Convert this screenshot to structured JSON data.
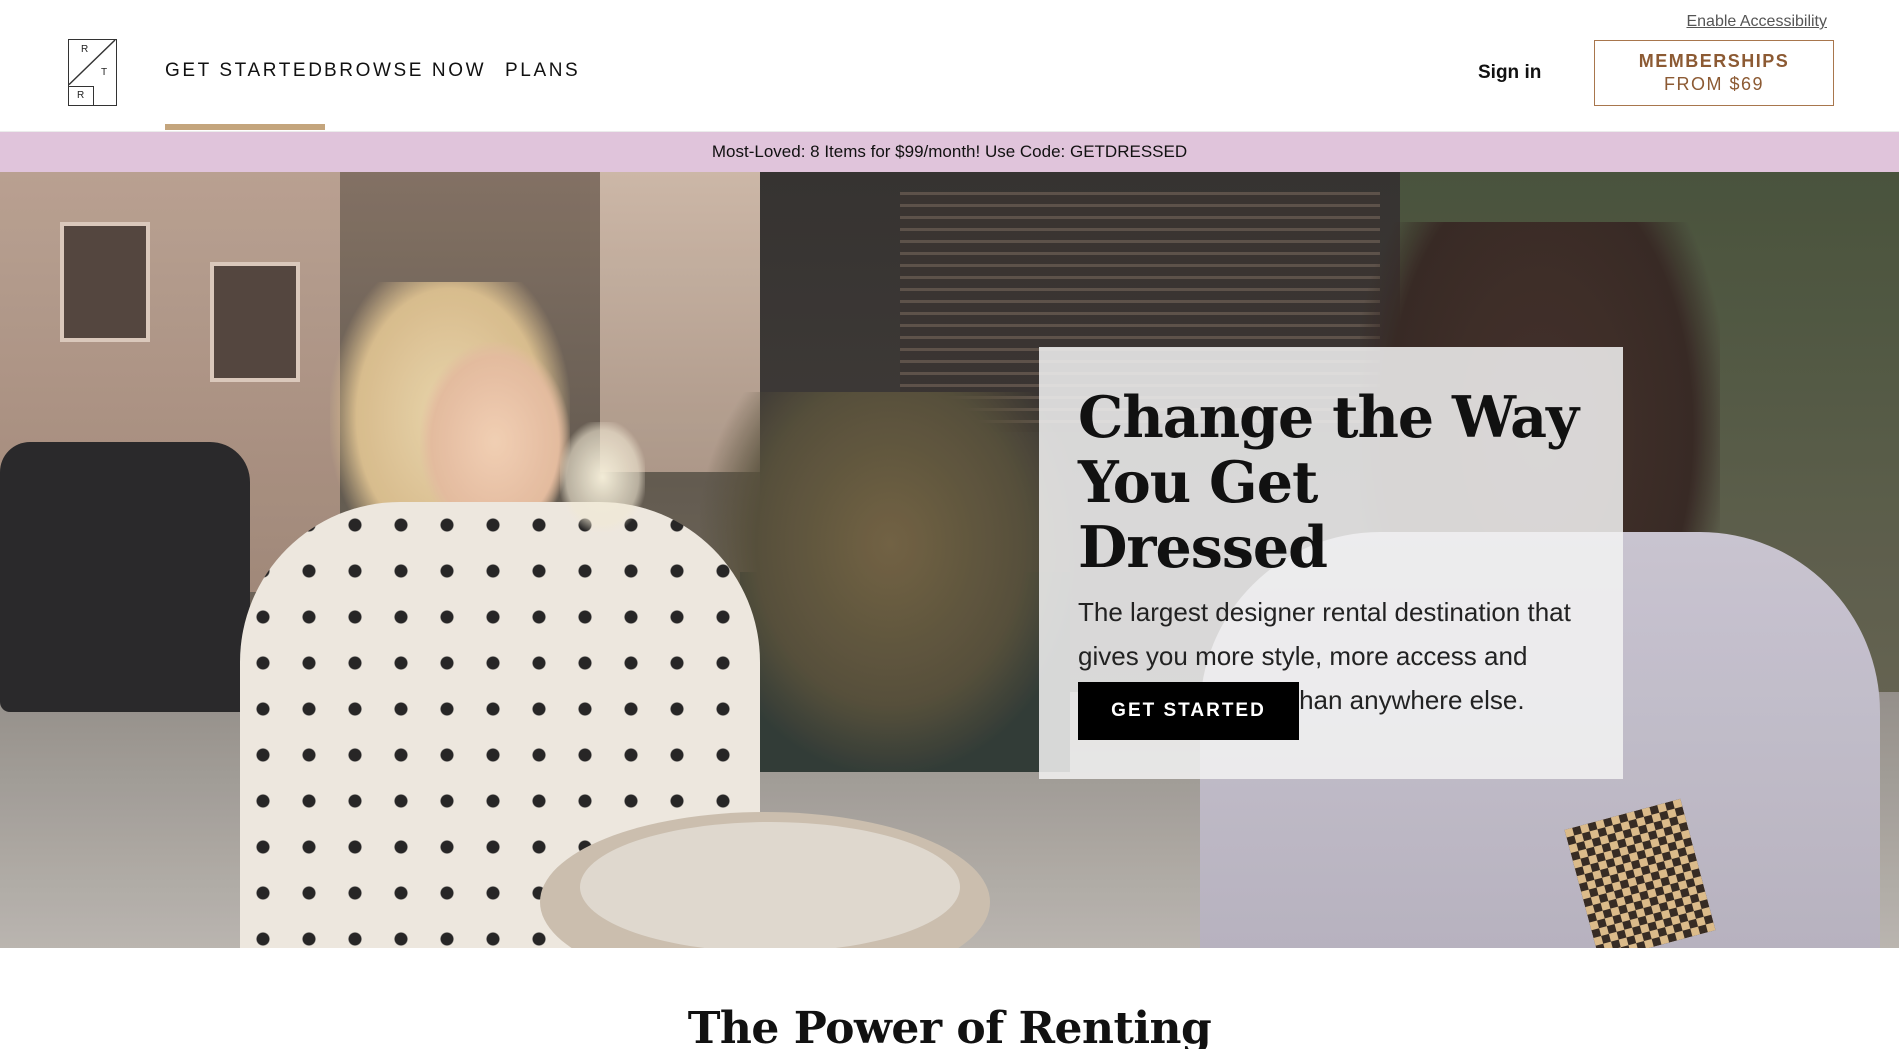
{
  "header": {
    "logo_letters": [
      "R",
      "T",
      "R"
    ],
    "nav": [
      {
        "label": "GET STARTED",
        "active": true
      },
      {
        "label": "BROWSE NOW",
        "active": false
      },
      {
        "label": "PLANS",
        "active": false
      }
    ],
    "accessibility_link": "Enable Accessibility",
    "sign_in": "Sign in",
    "membership": {
      "line1": "MEMBERSHIPS",
      "line2": "FROM $69"
    }
  },
  "promo": {
    "text": "Most-Loved: 8 Items for $99/month! Use Code: GETDRESSED",
    "background": "#e0c4db"
  },
  "hero": {
    "title_line1": "Change the Way",
    "title_line2": "You Get Dressed",
    "description": "The largest designer rental destination that gives you more style, more access and more ways to rent than anywhere else.",
    "cta": "GET STARTED"
  },
  "section": {
    "title": "The Power of Renting"
  },
  "colors": {
    "accent_bar": "#c4a57d",
    "membership_border": "#a8764d",
    "membership_text": "#8c5a33",
    "cta_background": "#000000"
  }
}
